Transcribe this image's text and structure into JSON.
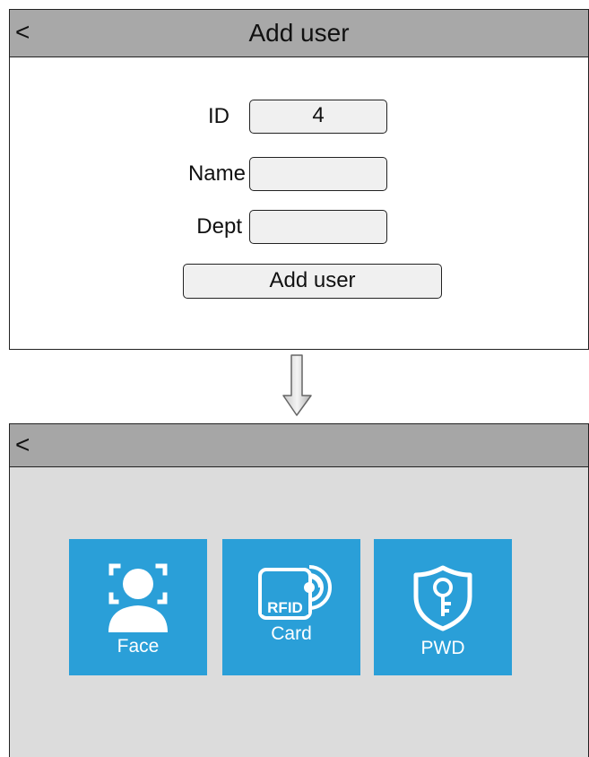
{
  "add_user_screen": {
    "back_label": "<",
    "title": "Add user",
    "fields": [
      {
        "label": "ID",
        "value": "4"
      },
      {
        "label": "Name",
        "value": ""
      },
      {
        "label": "Dept",
        "value": ""
      }
    ],
    "submit_label": "Add user"
  },
  "method_screen": {
    "back_label": "<",
    "tiles": [
      {
        "label": "Face",
        "icon": "face-icon"
      },
      {
        "label": "Card",
        "icon": "rfid-card-icon",
        "icon_text": "RFID"
      },
      {
        "label": "PWD",
        "icon": "key-shield-icon"
      }
    ]
  },
  "colors": {
    "header": "#a8a8a8",
    "tile": "#2a9fd8",
    "screen_bg": "#dcdcdc"
  }
}
